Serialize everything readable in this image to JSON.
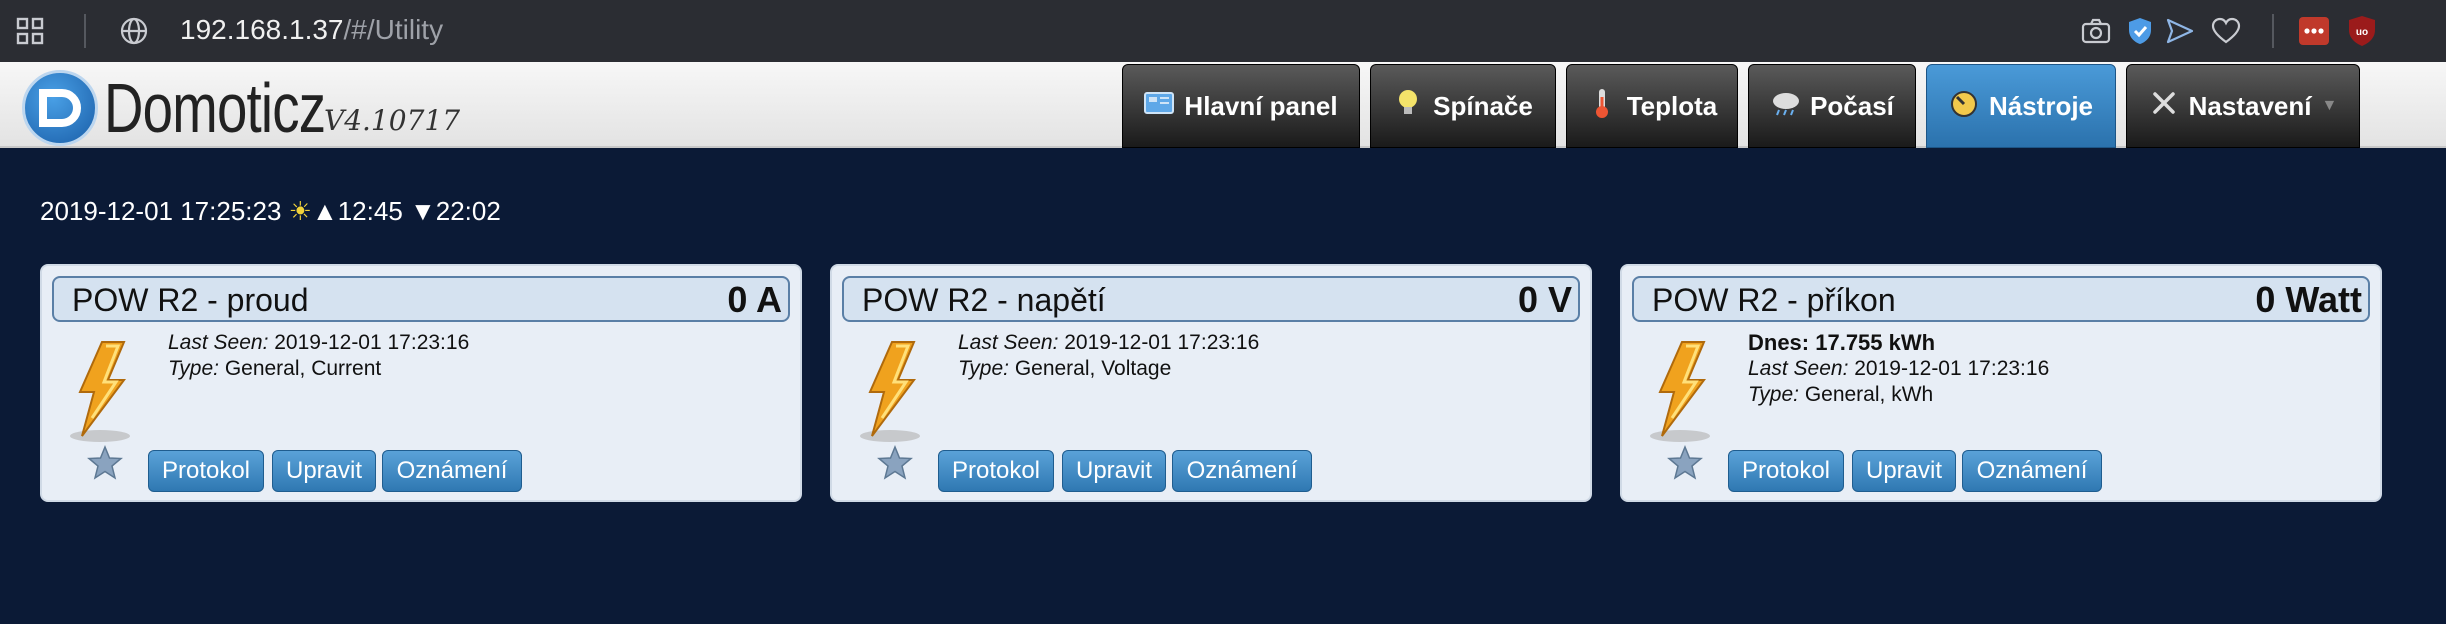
{
  "browser": {
    "url_host": "192.168.1.37",
    "url_path": "/#/Utility"
  },
  "app": {
    "logo_text": "Domoticz",
    "version": "V4.10717"
  },
  "nav": [
    {
      "label": "Hlavní panel",
      "icon": "dashboard-icon",
      "active": false
    },
    {
      "label": "Spínače",
      "icon": "bulb-icon",
      "active": false
    },
    {
      "label": "Teplota",
      "icon": "thermometer-icon",
      "active": false
    },
    {
      "label": "Počasí",
      "icon": "weather-icon",
      "active": false
    },
    {
      "label": "Nástroje",
      "icon": "gauge-icon",
      "active": true
    },
    {
      "label": "Nastavení",
      "icon": "tools-icon",
      "active": false
    }
  ],
  "clock": {
    "datetime": "2019-12-01 17:25:23",
    "sunrise": "12:45",
    "sunset": "22:02"
  },
  "buttons": {
    "log": "Protokol",
    "edit": "Upravit",
    "notify": "Oznámení"
  },
  "cards": [
    {
      "title": "POW R2 - proud",
      "value": "0 A",
      "today": "",
      "last_seen_label": "Last Seen:",
      "last_seen": "2019-12-01 17:23:16",
      "type_label": "Type:",
      "type": "General, Current"
    },
    {
      "title": "POW R2 - napětí",
      "value": "0 V",
      "today": "",
      "last_seen_label": "Last Seen:",
      "last_seen": "2019-12-01 17:23:16",
      "type_label": "Type:",
      "type": "General, Voltage"
    },
    {
      "title": "POW R2 - příkon",
      "value": "0 Watt",
      "today": "Dnes: 17.755 kWh",
      "last_seen_label": "Last Seen:",
      "last_seen": "2019-12-01 17:23:16",
      "type_label": "Type:",
      "type": "General, kWh"
    }
  ],
  "colors": {
    "page_bg": "#0b1a36",
    "accent": "#2f78b2",
    "card_bg": "#e8eef6"
  }
}
